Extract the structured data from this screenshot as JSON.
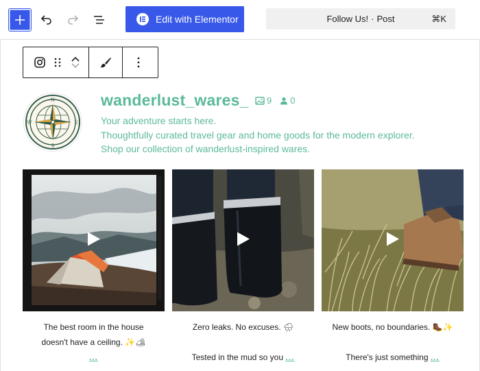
{
  "topbar": {
    "add_label": "Add block",
    "elementor_label": "Edit with Elementor",
    "doc_title": "Follow Us!",
    "doc_separator": "·",
    "doc_type": "Post",
    "shortcut": "⌘K"
  },
  "profile": {
    "username": "wanderlust_wares_",
    "posts_count": "9",
    "followers_count": "0",
    "bio": [
      "Your adventure starts here.",
      "Thoughtfully curated travel gear and home goods for the modern explorer.",
      "Shop our collection of wanderlust-inspired wares."
    ],
    "avatar_letters": {
      "n": "N",
      "s": "S",
      "w": "W",
      "e": "E"
    }
  },
  "feed": [
    {
      "lines": [
        "The best room in the house",
        "doesn't have a ceiling. ✨🏕"
      ],
      "more": "..."
    },
    {
      "lines": [
        "Zero leaks. No excuses. 🌧",
        "",
        "Tested in the mud so you"
      ],
      "more": "..."
    },
    {
      "lines": [
        "New boots, no boundaries. 🥾✨",
        "",
        "There's just something"
      ],
      "more": "..."
    }
  ],
  "colors": {
    "accent": "#3858e9",
    "green": "#5bb99a"
  }
}
